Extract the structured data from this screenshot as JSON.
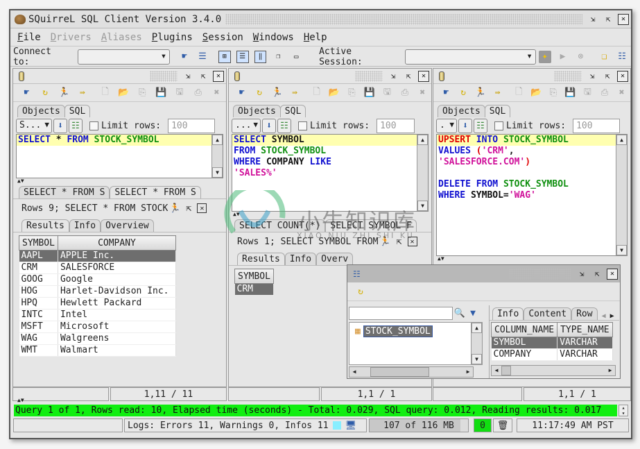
{
  "window": {
    "title": "SQuirreL SQL Client Version 3.4.0"
  },
  "menu": [
    {
      "label": "File",
      "mnemonic": "F",
      "rest": "ile",
      "enabled": true
    },
    {
      "label": "Drivers",
      "mnemonic": "D",
      "rest": "rivers",
      "enabled": false
    },
    {
      "label": "Aliases",
      "mnemonic": "A",
      "rest": "liases",
      "enabled": false
    },
    {
      "label": "Plugins",
      "mnemonic": "P",
      "rest": "lugins",
      "enabled": true
    },
    {
      "label": "Session",
      "mnemonic": "S",
      "rest": "ession",
      "enabled": true
    },
    {
      "label": "Windows",
      "mnemonic": "W",
      "rest": "indows",
      "enabled": true
    },
    {
      "label": "Help",
      "mnemonic": "H",
      "rest": "elp",
      "enabled": true
    }
  ],
  "toolbar": {
    "connect_label": "Connect to:",
    "connect_value": "",
    "active_session_label": "Active Session:",
    "active_session_value": ""
  },
  "sessions": [
    {
      "tabs": {
        "objects": "Objects",
        "sql": "SQL"
      },
      "sql_combo": "S...",
      "limit_label": "Limit rows:",
      "limit_value": "100",
      "sql_lines": [
        [
          {
            "t": "SELECT",
            "c": "kw"
          },
          {
            "t": " * ",
            "c": "plain"
          },
          {
            "t": "FROM",
            "c": "kw"
          },
          {
            "t": " ",
            "c": "plain"
          },
          {
            "t": "STOCK_SYMBOL",
            "c": "tbl"
          }
        ]
      ],
      "result_tabs": [
        "SELECT * FROM S",
        "SELECT * FROM S"
      ],
      "rows_info": "Rows 9;  SELECT * FROM STOCK",
      "sub_tabs": [
        "Results",
        "Info",
        "Overview"
      ],
      "columns": [
        "SYMBOL",
        "COMPANY"
      ],
      "rows": [
        [
          "AAPL",
          "APPLE Inc."
        ],
        [
          "CRM",
          "SALESFORCE"
        ],
        [
          "GOOG",
          "Google"
        ],
        [
          "HOG",
          "Harlet-Davidson Inc."
        ],
        [
          "HPQ",
          "Hewlett Packard"
        ],
        [
          "INTC",
          "Intel"
        ],
        [
          "MSFT",
          "Microsoft"
        ],
        [
          "WAG",
          "Walgreens"
        ],
        [
          "WMT",
          "Walmart"
        ]
      ],
      "selected_row": 0,
      "position": "1,11 / 11"
    },
    {
      "tabs": {
        "objects": "Objects",
        "sql": "SQL"
      },
      "sql_combo": "...",
      "limit_label": "Limit rows:",
      "limit_value": "100",
      "sql_lines": [
        [
          {
            "t": "SELECT",
            "c": "kw"
          },
          {
            "t": " SYMBOL",
            "c": "plain"
          }
        ],
        [
          {
            "t": "FROM",
            "c": "kw"
          },
          {
            "t": " ",
            "c": "plain"
          },
          {
            "t": "STOCK_SYMBOL",
            "c": "tbl"
          }
        ],
        [
          {
            "t": "WHERE",
            "c": "kw"
          },
          {
            "t": " COMPANY ",
            "c": "plain"
          },
          {
            "t": "LIKE",
            "c": "kw"
          }
        ],
        [
          {
            "t": "'SALES%'",
            "c": "str"
          }
        ]
      ],
      "result_tabs": [
        "SELECT COUNT(*)",
        "SELECT SYMBOL F"
      ],
      "rows_info": "Rows 1;  SELECT SYMBOL FROM",
      "sub_tabs": [
        "Results",
        "Info",
        "Overv"
      ],
      "columns": [
        "SYMBOL"
      ],
      "rows": [
        [
          "CRM"
        ]
      ],
      "selected_row": 0,
      "position": "1,1 / 1"
    },
    {
      "tabs": {
        "objects": "Objects",
        "sql": "SQL"
      },
      "sql_combo": ".",
      "limit_label": "Limit rows:",
      "limit_value": "100",
      "sql_lines": [
        [
          {
            "t": "UPSERT",
            "c": "red"
          },
          {
            "t": " ",
            "c": "plain"
          },
          {
            "t": "INTO",
            "c": "kw"
          },
          {
            "t": " ",
            "c": "plain"
          },
          {
            "t": "STOCK_SYMBOL",
            "c": "tbl"
          }
        ],
        [
          {
            "t": "VALUES",
            "c": "kw"
          },
          {
            "t": " ",
            "c": "plain"
          },
          {
            "t": "(",
            "c": "red"
          },
          {
            "t": "'CRM'",
            "c": "str"
          },
          {
            "t": ",",
            "c": "plain"
          }
        ],
        [
          {
            "t": "'SALESFORCE.COM'",
            "c": "str"
          },
          {
            "t": ")",
            "c": "red"
          }
        ],
        [],
        [
          {
            "t": "DELETE",
            "c": "kw"
          },
          {
            "t": " ",
            "c": "plain"
          },
          {
            "t": "FROM",
            "c": "kw"
          },
          {
            "t": " ",
            "c": "plain"
          },
          {
            "t": "STOCK_SYMBOL",
            "c": "tbl"
          }
        ],
        [
          {
            "t": "WHERE",
            "c": "kw"
          },
          {
            "t": " SYMBOL=",
            "c": "plain"
          },
          {
            "t": "'WAG'",
            "c": "str"
          }
        ]
      ],
      "position": "1,1 / 1"
    }
  ],
  "object_tree_window": {
    "search_value": "",
    "tree_items": [
      "STOCK_SYMBOL"
    ],
    "detail_tabs": [
      "Info",
      "Content",
      "Row"
    ],
    "columns": [
      "COLUMN_NAME",
      "TYPE_NAME"
    ],
    "rows": [
      [
        "SYMBOL",
        "VARCHAR"
      ],
      [
        "COMPANY",
        "VARCHAR"
      ]
    ],
    "selected_row": 0
  },
  "status": {
    "message": "Query 1 of 1, Rows read: 10, Elapsed time (seconds) - Total: 0.029, SQL query: 0.012, Reading results: 0.017",
    "logs": "Logs: Errors 11, Warnings 0, Infos 11",
    "memory": "107 of 116 MB",
    "memory_used_fraction": 0.92,
    "gc_count": "0",
    "clock": "11:17:49 AM PST"
  },
  "watermark": {
    "text": "小牛知识库",
    "subtext": "XIAO NIU ZHI SHI KU"
  },
  "colors": {
    "status_ok": "#11ee11",
    "sql_keyword": "#1010d0",
    "sql_table": "#109010",
    "sql_string": "#d0109a",
    "sql_dml": "#e00000",
    "current_line": "#ffffb0",
    "selected_row": "#6e6e6e"
  }
}
